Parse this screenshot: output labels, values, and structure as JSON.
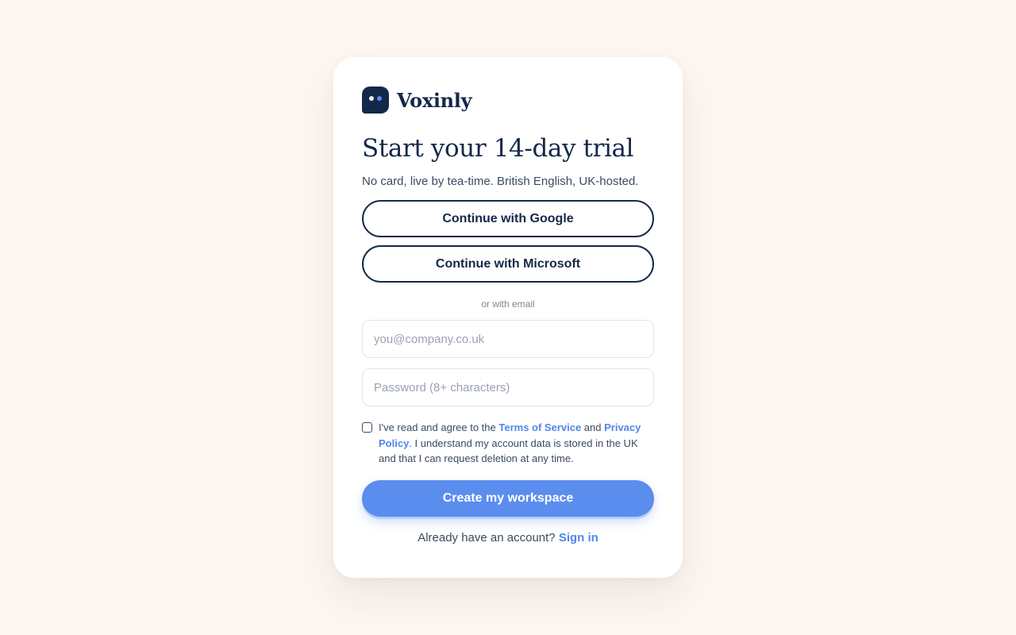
{
  "brand": {
    "name": "Voxinly",
    "logo_icon": "robot-face-icon",
    "colors": {
      "navy": "#14284a",
      "accent": "#5b8def",
      "background": "#fdf6f1"
    }
  },
  "heading": "Start your 14-day trial",
  "subtitle": "No card, live by tea-time. British English, UK-hosted.",
  "oauth": {
    "google_label": "Continue with Google",
    "microsoft_label": "Continue with Microsoft"
  },
  "divider_text": "or with email",
  "form": {
    "email_placeholder": "you@company.co.uk",
    "email_value": "",
    "password_placeholder": "Password (8+ characters)",
    "password_value": ""
  },
  "consent": {
    "checked": false,
    "prefix": "I've read and agree to the ",
    "terms_link": "Terms of Service",
    "middle": " and ",
    "privacy_link": "Privacy Policy",
    "suffix": ". I understand my account data is stored in the UK and that I can request deletion at any time."
  },
  "cta_label": "Create my workspace",
  "signin": {
    "prompt": "Already have an account?",
    "link": "Sign in"
  }
}
